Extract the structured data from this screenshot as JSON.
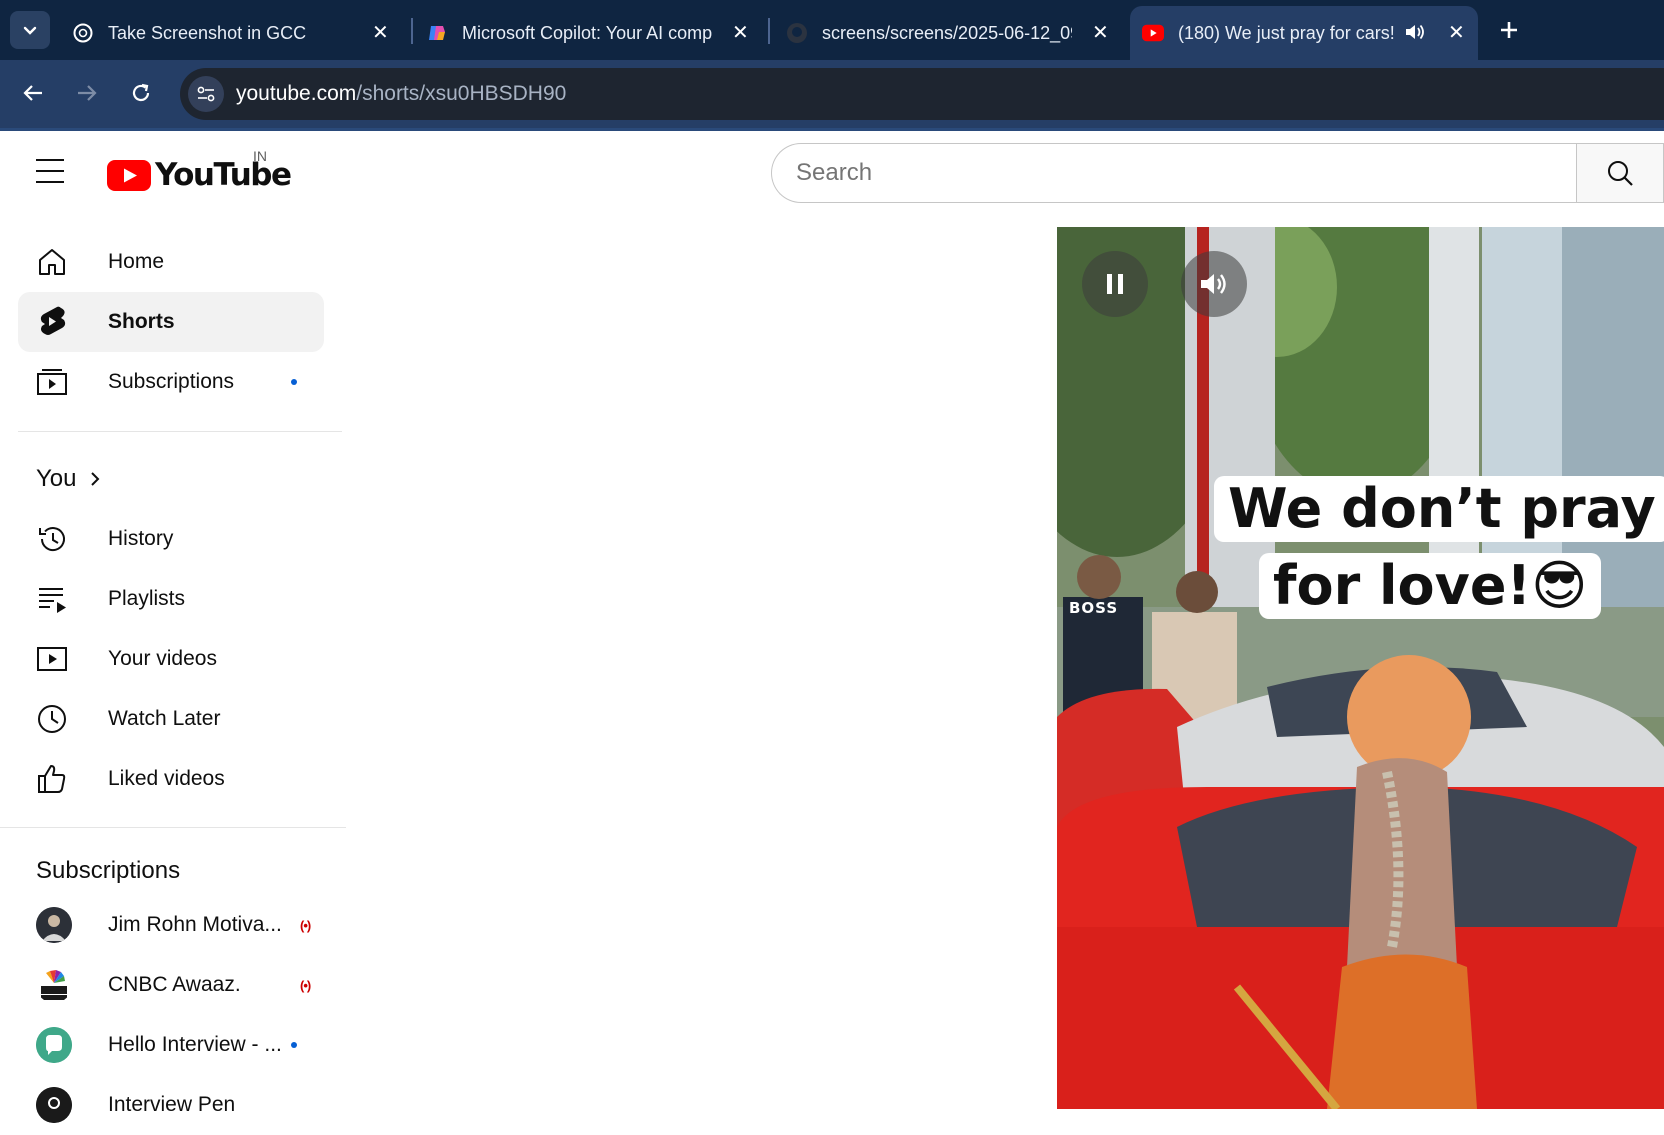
{
  "browser": {
    "tabs": [
      {
        "title": "Take Screenshot in GCC",
        "icon": "chatgpt-icon",
        "active": false
      },
      {
        "title": "Microsoft Copilot: Your AI comp",
        "icon": "copilot-icon",
        "active": false
      },
      {
        "title": "screens/screens/2025-06-12_09",
        "icon": "github-icon",
        "active": false
      },
      {
        "title": "(180) We just pray for cars!",
        "icon": "youtube-icon",
        "active": true,
        "audio": true
      }
    ],
    "url_host": "youtube.com",
    "url_path": "/shorts/xsu0HBSDH90"
  },
  "header": {
    "logo_text": "YouTube",
    "country": "IN",
    "search_placeholder": "Search"
  },
  "sidebar": {
    "main": [
      {
        "label": "Home",
        "icon": "home-icon"
      },
      {
        "label": "Shorts",
        "icon": "shorts-icon",
        "active": true
      },
      {
        "label": "Subscriptions",
        "icon": "subscriptions-icon",
        "new": true
      }
    ],
    "you_title": "You",
    "you_items": [
      {
        "label": "History",
        "icon": "history-icon"
      },
      {
        "label": "Playlists",
        "icon": "playlists-icon"
      },
      {
        "label": "Your videos",
        "icon": "your-videos-icon"
      },
      {
        "label": "Watch Later",
        "icon": "watch-later-icon"
      },
      {
        "label": "Liked videos",
        "icon": "thumbs-up-icon"
      }
    ],
    "subs_title": "Subscriptions",
    "subscriptions": [
      {
        "label": "Jim Rohn Motiva...",
        "status": "live"
      },
      {
        "label": "CNBC Awaaz.",
        "status": "live"
      },
      {
        "label": "Hello Interview - ...",
        "status": "new"
      },
      {
        "label": "Interview Pen",
        "status": ""
      }
    ]
  },
  "video": {
    "caption_line1": "We don’t pray",
    "caption_line2": "for love!😎",
    "shirt_text": "BOSS"
  }
}
